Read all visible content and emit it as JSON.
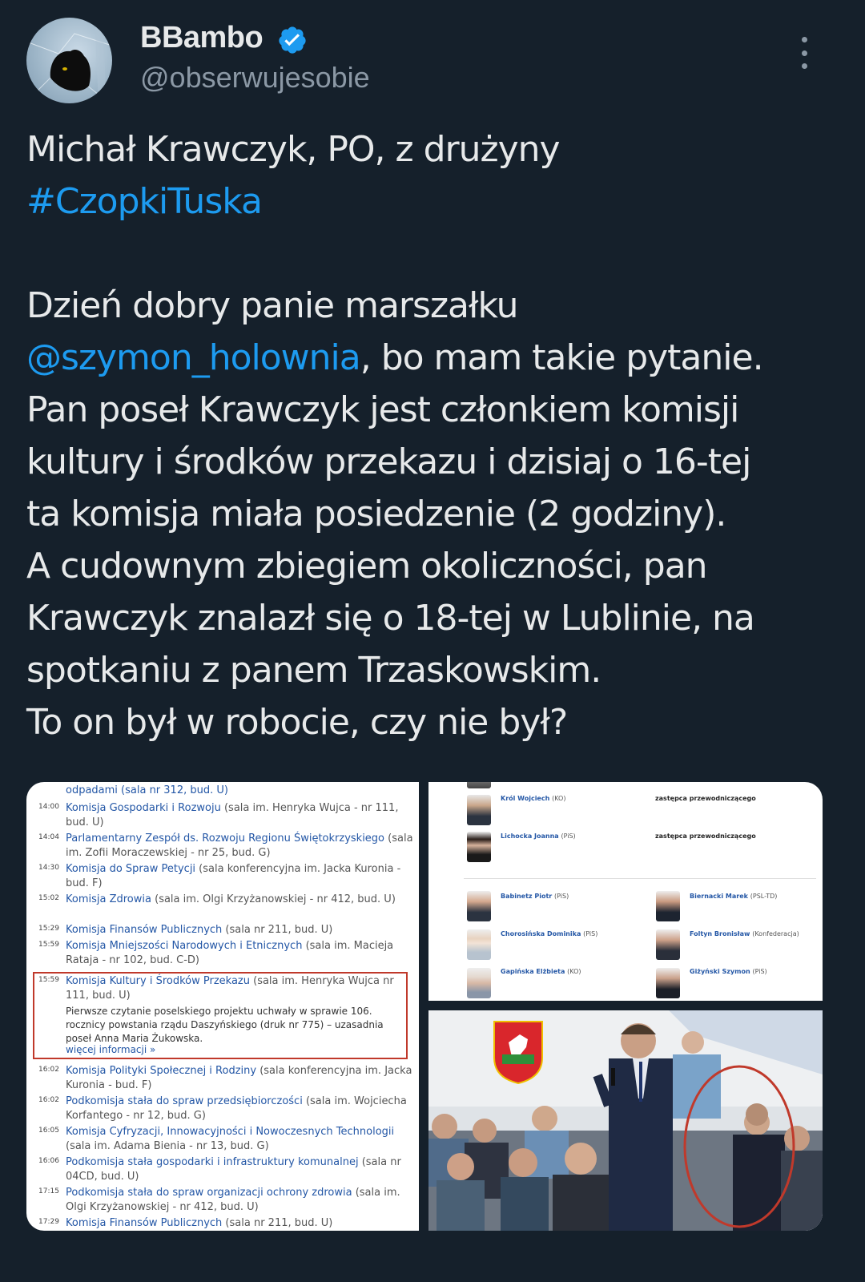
{
  "author": {
    "display_name": "BBambo",
    "handle": "@obserwujesobie",
    "verified": true,
    "avatar_icon": "black-cat-avatar",
    "verified_icon": "verified-badge-icon",
    "more_icon": "more-vertical-icon"
  },
  "tweet": {
    "line1": "Michał Krawczyk, PO, z drużyny",
    "hashtag": "#CzopkiTuska",
    "line3": "Dzień dobry panie marszałku",
    "mention": "@szymon_holownia",
    "line4_rest": ", bo mam takie pytanie.",
    "line5": "Pan poseł Krawczyk jest członkiem komisji",
    "line6": "kultury i środków przekazu i dzisiaj o 16-tej",
    "line7": "ta komisja miała posiedzenie (2 godziny).",
    "line8": "A cudownym zbiegiem okoliczności, pan",
    "line9": "Krawczyk znalazł się o 18-tej w Lublinie, na",
    "line10": "spotkaniu z panem Trzaskowskim.",
    "line11": "To on był w robocie, czy nie był?"
  },
  "schedule": {
    "top_partial": "odpadami (sala nr 312, bud. U)",
    "items": [
      {
        "time": "14:00",
        "name": "Komisja Gospodarki i Rozwoju",
        "loc": " (sala im. Henryka Wujca - nr 111, bud. U)"
      },
      {
        "time": "14:04",
        "name": "Parlamentarny Zespół ds. Rozwoju Regionu Świętokrzyskiego",
        "loc": " (sala im. Zofii Moraczewskiej - nr 25, bud. G)"
      },
      {
        "time": "14:30",
        "name": "Komisja do Spraw Petycji",
        "loc": " (sala konferencyjna im. Jacka Kuronia - bud. F)"
      },
      {
        "time": "15:02",
        "name": "Komisja Zdrowia",
        "loc": " (sala im. Olgi Krzyżanowskiej - nr 412, bud. U)"
      },
      {
        "time": "15:29",
        "name": "Komisja Finansów Publicznych",
        "loc": " (sala nr 211, bud. U)"
      },
      {
        "time": "15:59",
        "name": "Komisja Mniejszości Narodowych i Etnicznych",
        "loc": " (sala im. Macieja Rataja - nr 102, bud. C-D)"
      },
      {
        "time": "15:59",
        "name": "Komisja Kultury i Środków Przekazu",
        "loc": " (sala im. Henryka Wujca nr 111, bud. U)"
      },
      {
        "time": "16:02",
        "name": "Komisja Polityki Społecznej i Rodziny",
        "loc": " (sala konferencyjna im. Jacka Kuronia - bud. F)"
      },
      {
        "time": "16:02",
        "name": "Podkomisja stała do spraw przedsiębiorczości",
        "loc": " (sala im. Wojciecha Korfantego - nr 12, bud. G)"
      },
      {
        "time": "16:05",
        "name": "Komisja Cyfryzacji, Innowacyjności i Nowoczesnych Technologii",
        "loc": " (sala im. Adama Bienia - nr 13, bud. G)"
      },
      {
        "time": "16:06",
        "name": "Podkomisja stała gospodarki i infrastruktury komunalnej",
        "loc": " (sala nr 04CD, bud. U)"
      },
      {
        "time": "17:15",
        "name": "Podkomisja stała do spraw organizacji ochrony zdrowia",
        "loc": " (sala im. Olgi Krzyżanowskiej - nr 412, bud. U)"
      },
      {
        "time": "17:29",
        "name": "Komisja Finansów Publicznych",
        "loc": " (sala nr 211, bud. U)"
      }
    ],
    "highlight_desc": "Pierwsze czytanie poselskiego projektu uchwały w sprawie 106. rocznicy powstania rządu Daszyńskiego (druk nr 775) – uzasadnia poseł Anna Maria Żukowska.",
    "more_info": "więcej informacji »"
  },
  "members": {
    "leaders": [
      {
        "name": "Król Wojciech",
        "party": "(KO)",
        "role": "zastępca przewodniczącego"
      },
      {
        "name": "Lichocka Joanna",
        "party": "(PiS)",
        "role": "zastępca przewodniczącego"
      }
    ],
    "grid": [
      {
        "name": "Babinetz Piotr",
        "party": "(PiS)"
      },
      {
        "name": "Biernacki Marek",
        "party": "(PSL-TD)"
      },
      {
        "name": "Chorosińska Dominika",
        "party": "(PiS)"
      },
      {
        "name": "Foltyn Bronisław",
        "party": "(Konfederacja)"
      },
      {
        "name": "Gapińska Elżbieta",
        "party": "(KO)"
      },
      {
        "name": "Giżyński Szymon",
        "party": "(PiS)"
      }
    ]
  },
  "colors": {
    "background": "#15202b",
    "link": "#1d9bf0",
    "verified": "#1d9bf0",
    "highlight_border": "#c0392b"
  }
}
